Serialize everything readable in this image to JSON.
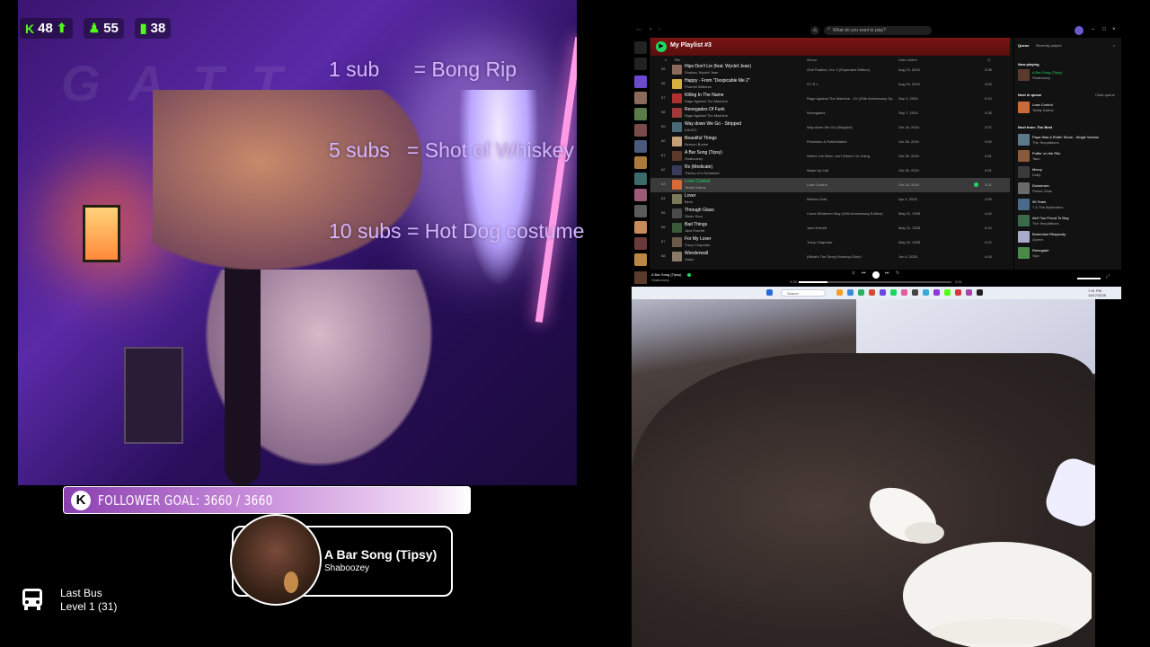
{
  "stats": {
    "kick_count": "48",
    "followers_count": "55",
    "viewers_count": "38"
  },
  "sub_goals": {
    "line1": "1 sub      = Bong Rip",
    "line2": "5 subs   = Shot of Whiskey",
    "line3": "10 subs = Hot Dog costume"
  },
  "follower_goal": {
    "logo": "K",
    "label": "FOLLOWER GOAL: 3660 / 3660"
  },
  "now_playing": {
    "title": "A Bar Song (Tipsy)",
    "artist": "Shaboozey"
  },
  "last_bus": {
    "title": "Last Bus",
    "level": "Level 1  (31)"
  },
  "spotify": {
    "search_placeholder": "What do you want to play?",
    "playlist_title": "My Playlist #3",
    "columns": {
      "num": "#",
      "title": "Title",
      "album": "Album",
      "date": "Date added"
    },
    "tracks": [
      {
        "n": "55",
        "title": "Hips Don't Lie (feat. Wyclef Jean)",
        "artist": "Shakira, Wyclef Jean",
        "album": "Oral Fixation, Vol. 2 (Expanded Edition)",
        "date": "Aug 13, 2024",
        "dur": "3:38"
      },
      {
        "n": "56",
        "title": "Happy - From \"Despicable Me 2\"",
        "artist": "Pharrell Williams",
        "album": "G I R L",
        "date": "Aug 29, 2024",
        "dur": "3:53"
      },
      {
        "n": "57",
        "title": "Killing In The Name",
        "artist": "Rage Against The Machine",
        "album": "Rage Against The Machine - XX (20th Anniversary Sp...",
        "date": "Sep 3, 2024",
        "dur": "5:14"
      },
      {
        "n": "58",
        "title": "Renegades Of Funk",
        "artist": "Rage Against The Machine",
        "album": "Renegades",
        "date": "Sep 7, 2024",
        "dur": "4:35"
      },
      {
        "n": "59",
        "title": "Way down We Go - Stripped",
        "artist": "KALEO",
        "album": "Way down We Go (Stripped)",
        "date": "Oct 18, 2024",
        "dur": "3:37"
      },
      {
        "n": "60",
        "title": "Beautiful Things",
        "artist": "Benson Boone",
        "album": "Fireworks & Rollerblades",
        "date": "Oct 28, 2024",
        "dur": "3:00"
      },
      {
        "n": "61",
        "title": "A Bar Song (Tipsy)",
        "artist": "Shaboozey",
        "album": "Where I've Been, Isn't Where I'm Going",
        "date": "Oct 28, 2024",
        "dur": "2:51"
      },
      {
        "n": "62",
        "title": "Rx (Medicate)",
        "artist": "Theory of a Deadman",
        "album": "Wake Up Call",
        "date": "Oct 28, 2024",
        "dur": "2:51"
      },
      {
        "n": "63",
        "title": "Lose Control",
        "artist": "Teddy Swims",
        "album": "Lose Control",
        "date": "Oct 28, 2024",
        "dur": "3:31"
      },
      {
        "n": "64",
        "title": "Lover",
        "artist": "Beck",
        "album": "Mellow Gold",
        "date": "Apr 4, 2025",
        "dur": "2:55"
      },
      {
        "n": "65",
        "title": "Through Glass",
        "artist": "Stone Sour",
        "album": "Come Whatever May (10th Anniversary Edition)",
        "date": "May 21, 2025",
        "dur": "4:42"
      },
      {
        "n": "66",
        "title": "Bad Things",
        "artist": "Jace Everett",
        "album": "Jace Everett",
        "date": "May 21, 2025",
        "dur": "3:14"
      },
      {
        "n": "67",
        "title": "For My Lover",
        "artist": "Tracy Chapman",
        "album": "Tracy Chapman",
        "date": "May 22, 2025",
        "dur": "3:12"
      },
      {
        "n": "68",
        "title": "Wonderwall",
        "artist": "Oasis",
        "album": "(What's The Story) Morning Glory?",
        "date": "Jun 4, 2025",
        "dur": "4:18"
      }
    ],
    "queue": {
      "tab_queue": "Queue",
      "tab_recent": "Recently played",
      "now_playing_label": "Now playing",
      "now": {
        "title": "A Bar Song (Tipsy)",
        "artist": "Shaboozey"
      },
      "next_in_queue_label": "Next in queue",
      "clear_queue": "Clear queue",
      "next": {
        "title": "Lose Control",
        "artist": "Teddy Swims"
      },
      "next_from_label": "Next from: The Best",
      "from_list": [
        {
          "title": "Papa Was A Rollin' Stone - Single Version",
          "artist": "The Temptations"
        },
        {
          "title": "Puttin' on the Ritz",
          "artist": "Taco"
        },
        {
          "title": "Mercy",
          "artist": "Duffy"
        },
        {
          "title": "Downtown",
          "artist": "Petula Clark"
        },
        {
          "title": "96 Tears",
          "artist": "? & The Mysterians"
        },
        {
          "title": "Ain't Too Proud To Beg",
          "artist": "The Temptations"
        },
        {
          "title": "Bohemian Rhapsody",
          "artist": "Queen"
        },
        {
          "title": "Renegade",
          "artist": "Styx"
        }
      ]
    },
    "playbar": {
      "title": "A Bar Song (Tipsy)",
      "artist": "Shaboozey",
      "time_elapsed": "0:33",
      "time_total": "2:51",
      "progress": 0.19
    }
  },
  "taskbar": {
    "search": "Search",
    "time": "7:41 PM",
    "date": "10/17/2025"
  },
  "colors": {
    "spotify_green": "#1ed760",
    "sub_goal_text": "#d4b4ff",
    "playlist_header": "#7a1414"
  }
}
